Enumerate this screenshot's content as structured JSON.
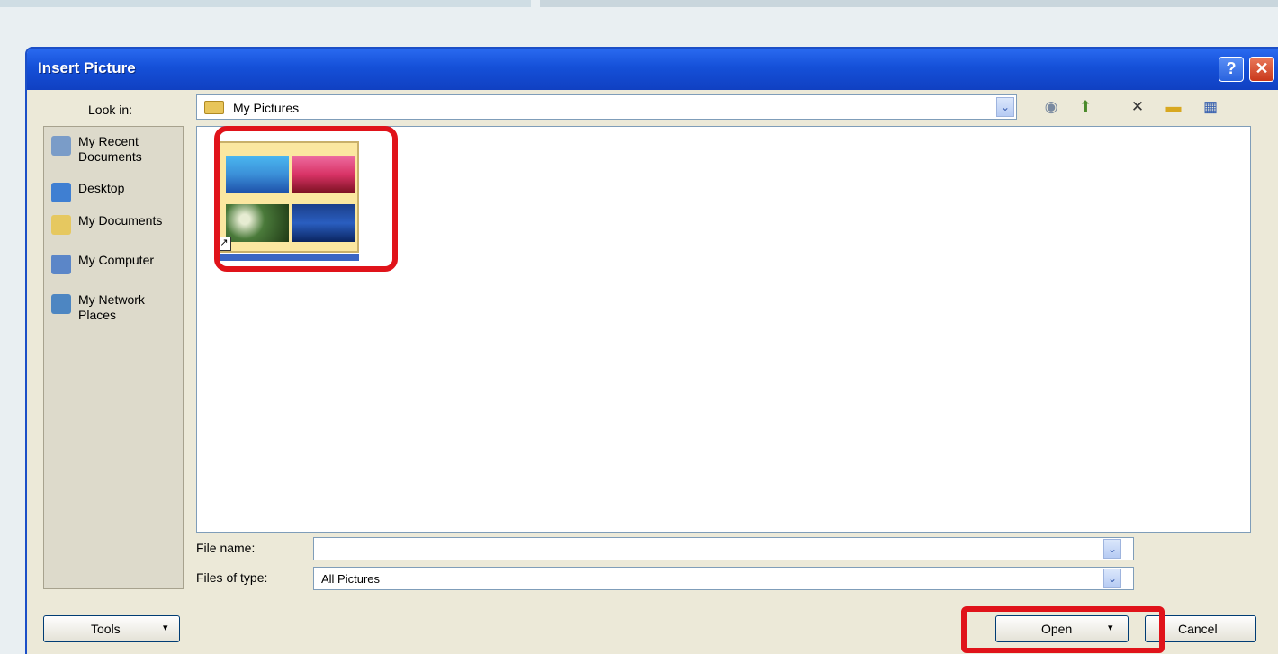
{
  "dialog": {
    "title": "Insert Picture",
    "help_symbol": "?",
    "close_symbol": "✕"
  },
  "look_in": {
    "label": "Look in:",
    "value": "My Pictures",
    "dropdown_symbol": "⌄"
  },
  "toolbar": {
    "icons": [
      {
        "name": "back-icon",
        "glyph": "◉"
      },
      {
        "name": "up-folder-icon",
        "glyph": "⬆"
      },
      {
        "name": "delete-icon",
        "glyph": "✕"
      },
      {
        "name": "new-folder-icon",
        "glyph": "▬"
      },
      {
        "name": "views-icon",
        "glyph": "▦"
      }
    ]
  },
  "places": [
    {
      "label": "My Recent Documents",
      "icon": "recent-documents-icon",
      "color": "#7a9cc8"
    },
    {
      "label": "Desktop",
      "icon": "desktop-icon",
      "color": "#3f7fd2"
    },
    {
      "label": "My Documents",
      "icon": "my-documents-icon",
      "color": "#e6c860"
    },
    {
      "label": "My Computer",
      "icon": "my-computer-icon",
      "color": "#5b86c8"
    },
    {
      "label": "My Network Places",
      "icon": "network-places-icon",
      "color": "#4d86c2"
    }
  ],
  "file_name": {
    "label": "File name:",
    "value": ""
  },
  "files_of_type": {
    "label": "Files of type:",
    "value": "All Pictures"
  },
  "buttons": {
    "tools": "Tools",
    "open": "Open",
    "cancel": "Cancel"
  },
  "colors": {
    "highlight": "#e0131a",
    "titlebar": "#1550d8"
  }
}
